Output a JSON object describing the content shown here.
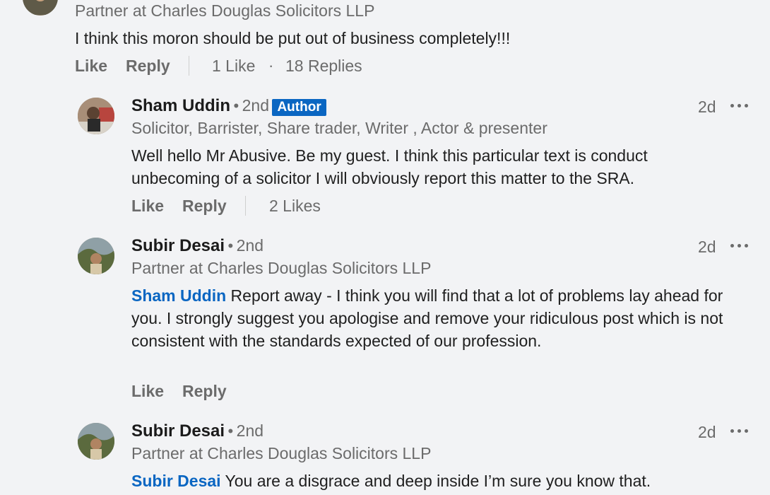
{
  "comments": [
    {
      "headline": "Partner at Charles Douglas Solicitors LLP",
      "text": "I think this moron should be put out of business completely!!!",
      "actions": {
        "like": "Like",
        "reply": "Reply"
      },
      "likes_count": "1 Like",
      "replies_count": "18 Replies"
    }
  ],
  "replies": [
    {
      "author": "Sham Uddin",
      "degree": "2nd",
      "badge": "Author",
      "headline": "Solicitor, Barrister, Share trader, Writer , Actor & presenter",
      "time": "2d",
      "text": "Well hello Mr Abusive. Be my guest. I think this particular text is conduct unbecoming of a solicitor I will obviously report this matter to the SRA.",
      "actions": {
        "like": "Like",
        "reply": "Reply"
      },
      "likes_count": "2 Likes"
    },
    {
      "author": "Subir Desai",
      "degree": "2nd",
      "headline": "Partner at Charles Douglas Solicitors LLP",
      "time": "2d",
      "mention": "Sham Uddin",
      "text": " Report away - I think you will find that a lot of problems lay ahead for you. I strongly suggest you apologise and remove your ridiculous post which is not consistent with the standards expected of our profession.",
      "actions": {
        "like": "Like",
        "reply": "Reply"
      }
    },
    {
      "author": "Subir Desai",
      "degree": "2nd",
      "headline": "Partner at Charles Douglas Solicitors LLP",
      "time": "2d",
      "mention": "Subir Desai",
      "text": " You are a disgrace and deep inside I’m sure you know that."
    }
  ],
  "symbols": {
    "dot": "•",
    "middot": "·"
  },
  "icons": {
    "more": "ellipsis-icon"
  },
  "colors": {
    "accent": "#0a66c2",
    "muted": "#6b6b6b",
    "background": "#f2f3f5"
  }
}
